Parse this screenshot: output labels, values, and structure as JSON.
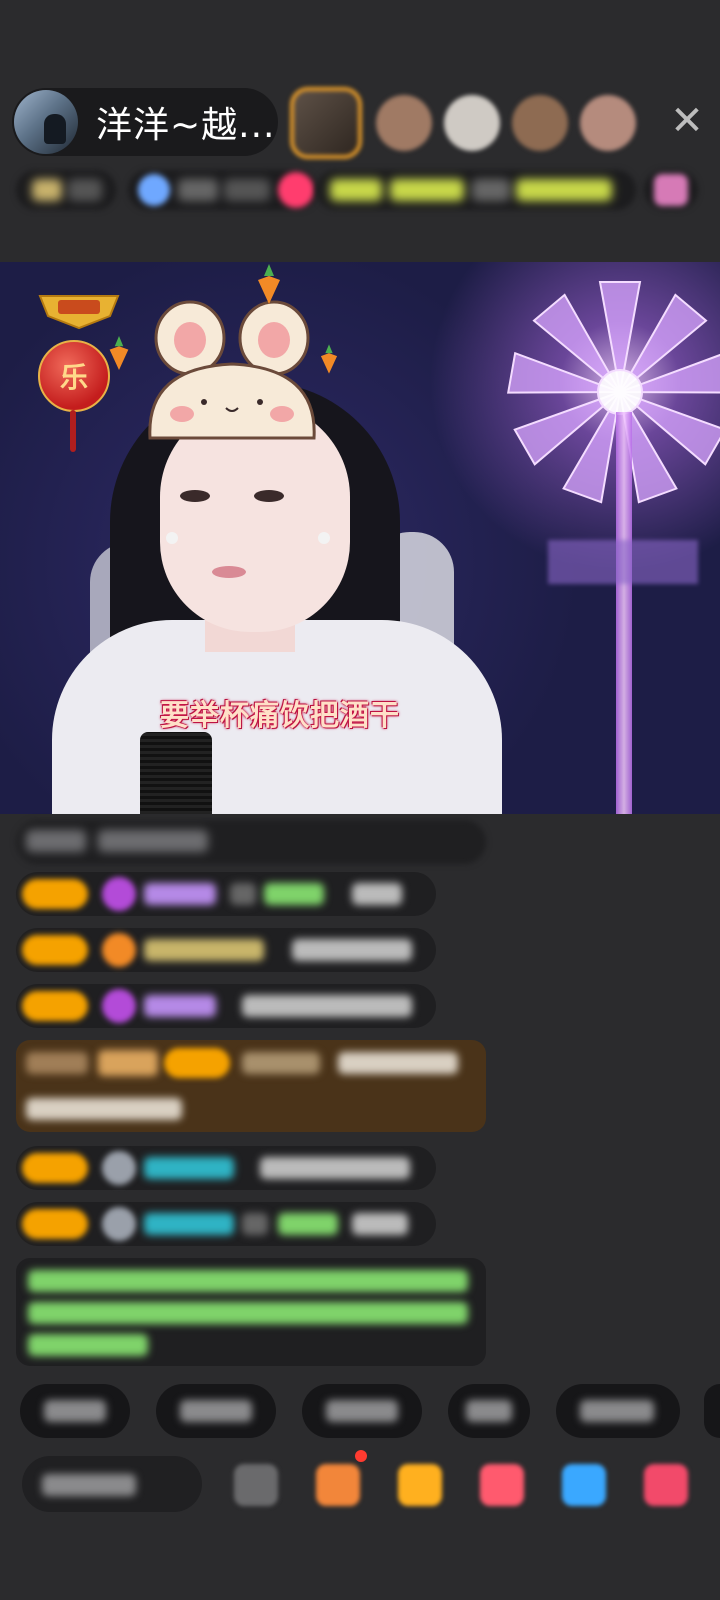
{
  "header": {
    "host_name": "洋洋~越...",
    "close_glyph": "✕"
  },
  "stream": {
    "lyric": "要举杯痛饮把酒干",
    "badge_glyph": "乐"
  },
  "colors": {
    "background": "#2b2b2d",
    "level_badge": "#f5a200",
    "gift_gem": "#b34bd8",
    "chat_highlight": "#4a3319",
    "username_purple": "#b589e6",
    "username_teal": "#2fb3c4",
    "notice_green": "#7fd36a"
  },
  "icons": {
    "close": "close-icon",
    "gift_gem": "gem-icon",
    "bunny_sticker": "bunny-sticker-icon",
    "carrot": "carrot-icon",
    "lantern": "lantern-icon"
  }
}
